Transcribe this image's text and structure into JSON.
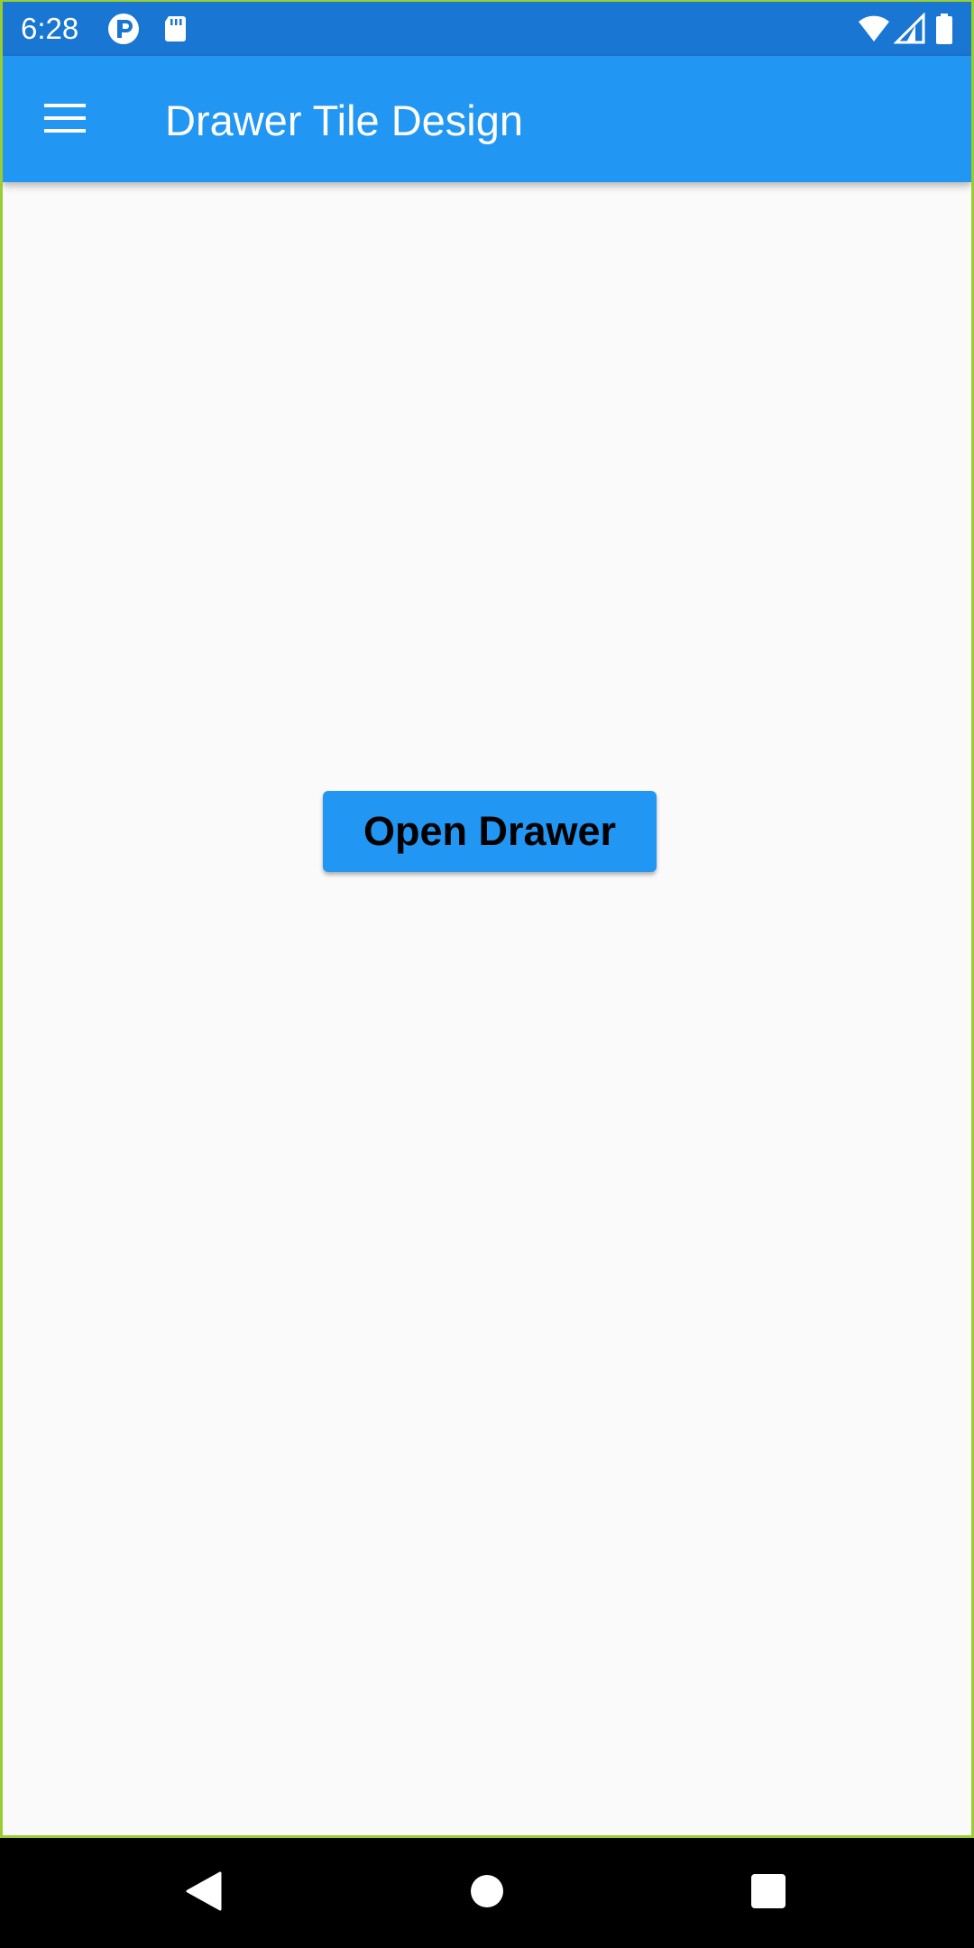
{
  "status_bar": {
    "time": "6:28",
    "icons": [
      "notification-p-icon",
      "sd-card-icon",
      "wifi-icon",
      "cell-signal-icon",
      "battery-icon"
    ]
  },
  "app_bar": {
    "title": "Drawer Tile Design",
    "menu_icon": "hamburger-menu-icon",
    "color": "#2196f3"
  },
  "main": {
    "button_label": "Open Drawer",
    "button_color": "#2196f3",
    "background": "#fafafa"
  },
  "nav_bar": {
    "buttons": [
      "back-icon",
      "home-icon",
      "recents-icon"
    ]
  }
}
